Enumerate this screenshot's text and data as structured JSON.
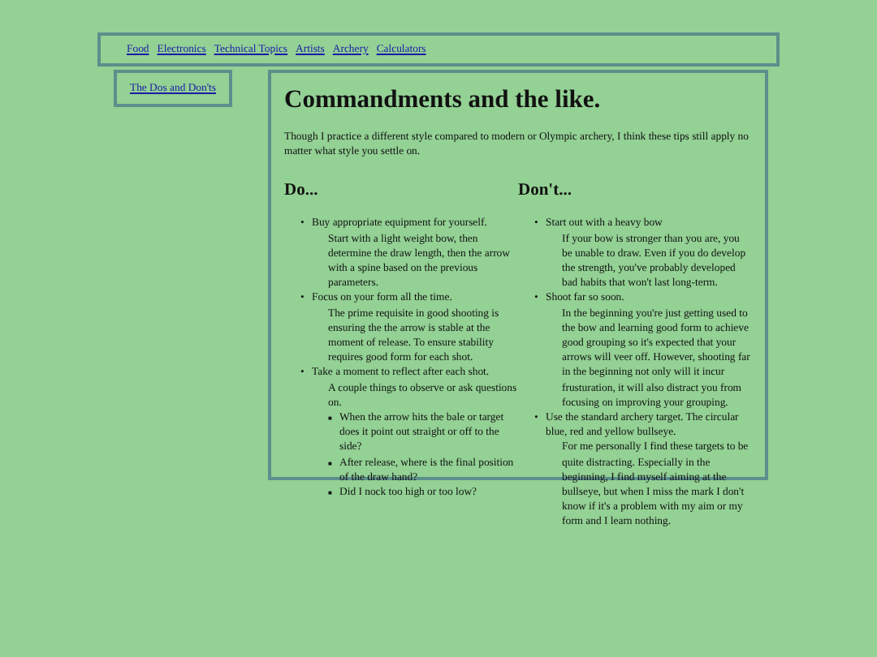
{
  "nav": {
    "links": [
      "Food",
      "Electronics",
      "Technical Topics",
      "Artists",
      "Archery",
      "Calculators"
    ]
  },
  "sidebar": {
    "links": [
      "The Dos and Don'ts"
    ]
  },
  "main": {
    "title": "Commandments and the like.",
    "intro": "Though I practice a different style compared to modern or Olympic archery, I think these tips still apply no matter what style you settle on.",
    "columns": [
      {
        "heading": "Do...",
        "items": [
          {
            "marker": "•",
            "text": "Buy appropriate equipment for yourself.",
            "detail": "Start with a light weight bow, then determine the draw length, then the arrow with a spine based on the previous parameters."
          },
          {
            "marker": "•",
            "text": "Focus on your form all the time.",
            "detail": "The prime requisite in good shooting is ensuring the the arrow is stable at the moment of release. To ensure stability requires good form for each shot."
          },
          {
            "marker": "•",
            "text": "Take a moment to reflect after each shot.",
            "detail": "A couple things to observe or ask questions on.",
            "children": [
              {
                "marker": "■",
                "text": "When the arrow hits the bale or target does it point out straight or off to the side?"
              },
              {
                "marker": "■",
                "text": "After release, where is the final position of the draw hand?"
              },
              {
                "marker": "■",
                "text": "Did I nock too high or too low?"
              }
            ]
          }
        ]
      },
      {
        "heading": "Don't...",
        "items": [
          {
            "marker": "•",
            "text": "Start out with a heavy bow",
            "detail": "If your bow is stronger than you are, you be unable to draw. Even if you do develop the strength, you've probably developed bad habits that won't last long-term."
          },
          {
            "marker": "•",
            "text": "Shoot far so soon.",
            "detail": "In the beginning you're just getting used to the bow and learning good form to achieve good grouping so it's expected that your arrows will veer off. However, shooting far in the beginning not only will it incur frusturation, it will also distract you from focusing on improving your grouping."
          },
          {
            "marker": "•",
            "text": "Use the standard archery target. The circular blue, red and yellow bullseye.",
            "detail": "For me personally I find these targets to be quite distracting. Especially in the beginning, I find myself aiming at the bullseye, but when I miss the mark I don't know if it's a problem with my aim or my form and I learn nothing."
          }
        ]
      }
    ]
  }
}
